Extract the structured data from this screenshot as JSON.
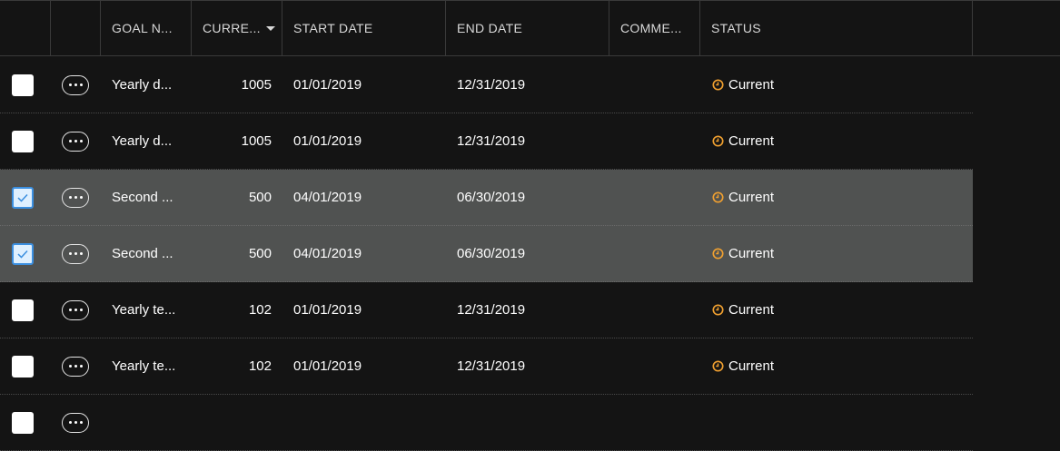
{
  "columns": [
    {
      "key": "select",
      "label": ""
    },
    {
      "key": "actions",
      "label": ""
    },
    {
      "key": "goal_name",
      "label": "GOAL N..."
    },
    {
      "key": "current",
      "label": "CURRE...",
      "sorted": "descending"
    },
    {
      "key": "start_date",
      "label": "START DATE"
    },
    {
      "key": "end_date",
      "label": "END DATE"
    },
    {
      "key": "comments",
      "label": "COMME..."
    },
    {
      "key": "status",
      "label": "STATUS"
    }
  ],
  "rows": [
    {
      "checked": false,
      "goal_name": "Yearly d...",
      "current": "1005",
      "start_date": "01/01/2019",
      "end_date": "12/31/2019",
      "comments": "",
      "status": "Current"
    },
    {
      "checked": false,
      "goal_name": "Yearly d...",
      "current": "1005",
      "start_date": "01/01/2019",
      "end_date": "12/31/2019",
      "comments": "",
      "status": "Current"
    },
    {
      "checked": true,
      "goal_name": "Second ...",
      "current": "500",
      "start_date": "04/01/2019",
      "end_date": "06/30/2019",
      "comments": "",
      "status": "Current"
    },
    {
      "checked": true,
      "goal_name": "Second ...",
      "current": "500",
      "start_date": "04/01/2019",
      "end_date": "06/30/2019",
      "comments": "",
      "status": "Current"
    },
    {
      "checked": false,
      "goal_name": "Yearly te...",
      "current": "102",
      "start_date": "01/01/2019",
      "end_date": "12/31/2019",
      "comments": "",
      "status": "Current"
    },
    {
      "checked": false,
      "goal_name": "Yearly te...",
      "current": "102",
      "start_date": "01/01/2019",
      "end_date": "12/31/2019",
      "comments": "",
      "status": "Current"
    },
    {
      "checked": false,
      "goal_name": "",
      "current": "",
      "start_date": "",
      "end_date": "",
      "comments": "",
      "status": ""
    }
  ],
  "colors": {
    "background": "#141414",
    "selected_row": "#505251",
    "status_icon": "#f0a030",
    "checkbox_check": "#3b8fe0"
  },
  "icons": {
    "status": "clock-icon",
    "actions": "more-options-icon",
    "sort": "sort-descending-icon",
    "check": "checkmark-icon"
  }
}
